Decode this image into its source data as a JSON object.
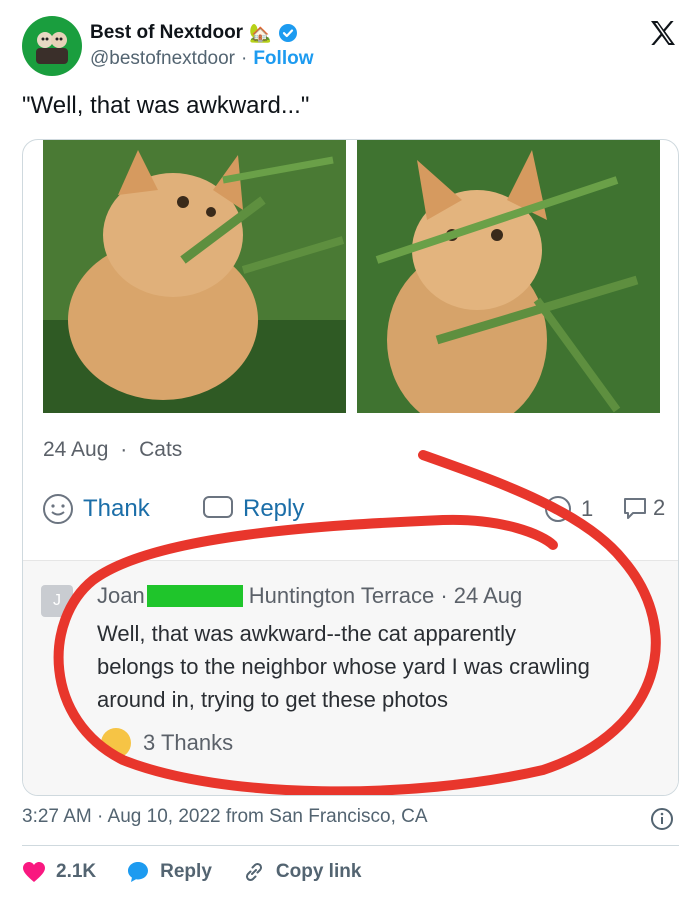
{
  "account": {
    "display_name": "Best of Nextdoor",
    "name_emoji": "🏡",
    "handle": "@bestofnextdoor",
    "separator": "·",
    "follow_label": "Follow",
    "verified_color": "#1d9bf0"
  },
  "tweet": {
    "text": "\"Well, that was awkward...\""
  },
  "post": {
    "date": "24 Aug",
    "dot": "·",
    "category": "Cats",
    "thank_label": "Thank",
    "reply_label": "Reply",
    "reaction_count": "1",
    "comment_count": "2"
  },
  "comment": {
    "avatar_letter": "J",
    "name": "Joan",
    "location": "Huntington Terrace · 24 Aug",
    "body": "Well, that was awkward--the cat apparently belongs to the neighbor whose yard I was crawling around in, trying to get these photos",
    "thanks": "3 Thanks"
  },
  "meta": {
    "timestamp": "3:27 AM · Aug 10, 2022 from San Francisco, CA"
  },
  "footer": {
    "likes": "2.1K",
    "reply_label": "Reply",
    "copy_label": "Copy link",
    "like_color": "#f91880",
    "reply_color": "#1d9bf0"
  }
}
